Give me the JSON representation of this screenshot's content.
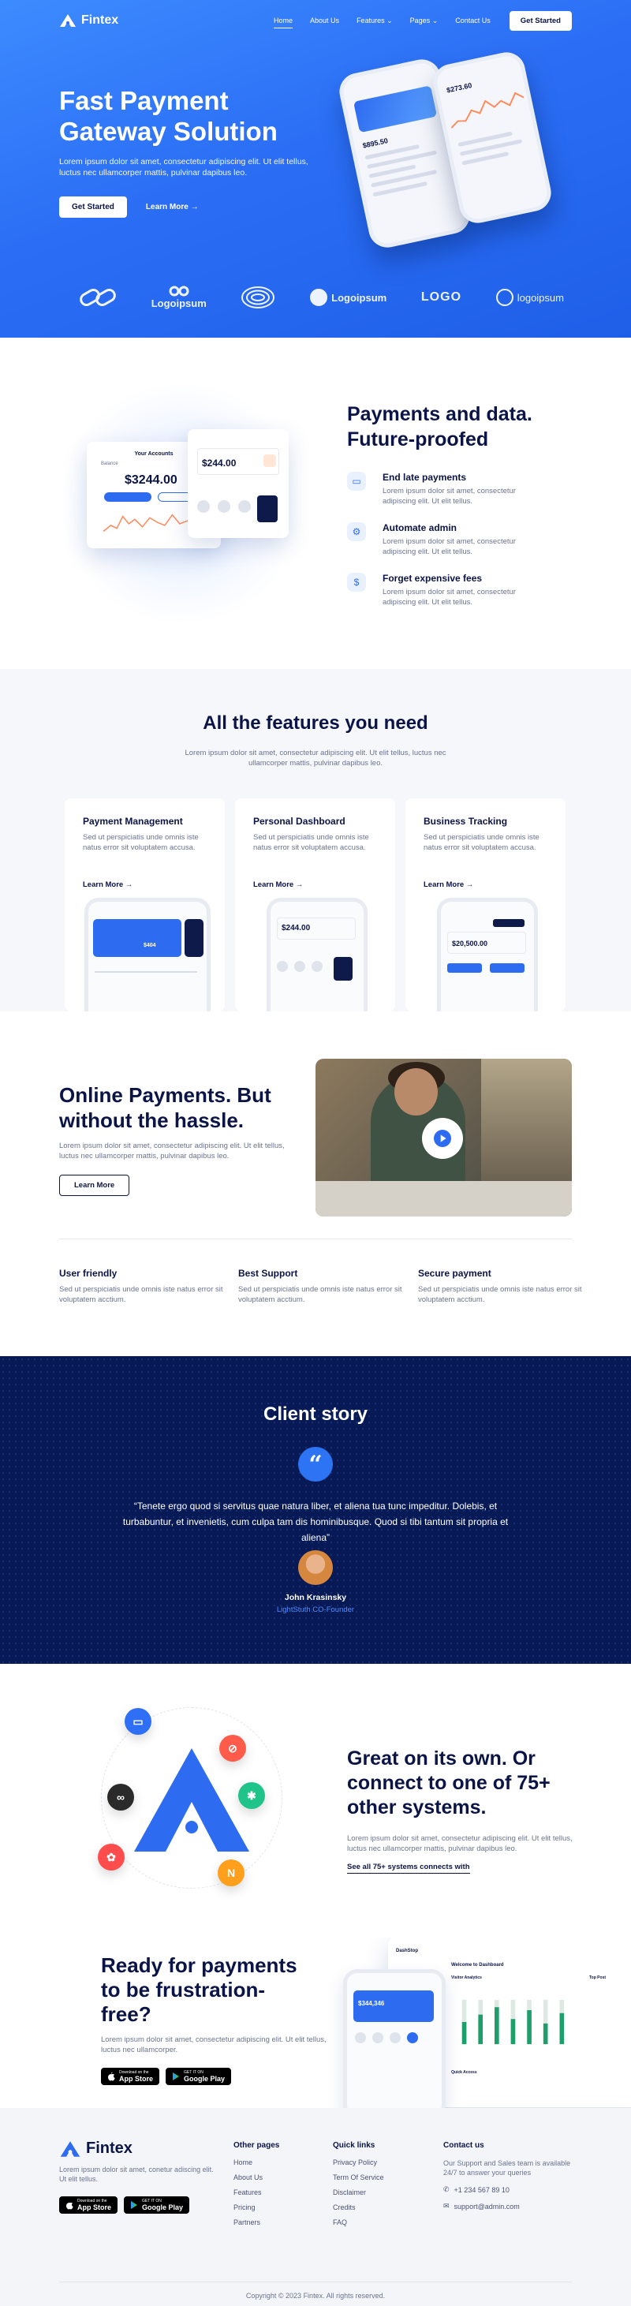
{
  "brand": {
    "name": "Fintex",
    "accent": "#2d6cf0",
    "navy": "#081a56"
  },
  "nav": {
    "links": [
      "Home",
      "About Us",
      "Features",
      "Pages",
      "Contact Us"
    ],
    "cta": "Get Started"
  },
  "hero": {
    "title": "Fast Payment Gateway Solution",
    "subtitle": "Lorem ipsum dolor sit amet, consectetur adipiscing elit. Ut elit tellus, luctus nec ullamcorper mattis, pulvinar dapibus leo.",
    "primary_btn": "Get Started",
    "secondary_btn": "Learn More",
    "phone_balance": "$895.50",
    "phone_balance2": "$273.60"
  },
  "logos": [
    "",
    "Logoipsum",
    "",
    "Logoipsum",
    "LOGO",
    "logoipsum"
  ],
  "payments": {
    "title": "Payments and data. Future-proofed",
    "dashboard": {
      "title": "Your Accounts",
      "label": "Balance",
      "balance": "$3244.00",
      "side_balance": "$244.00"
    },
    "features": [
      {
        "title": "End late payments",
        "text": "Lorem ipsum dolor sit amet, consectetur adipiscing elit. Ut elit tellus."
      },
      {
        "title": "Automate admin",
        "text": "Lorem ipsum dolor sit amet, consectetur adipiscing elit. Ut elit tellus."
      },
      {
        "title": "Forget expensive fees",
        "text": "Lorem ipsum dolor sit amet, consectetur adipiscing elit. Ut elit tellus."
      }
    ]
  },
  "features": {
    "title": "All the features you need",
    "lead": "Lorem ipsum dolor sit amet, consectetur adipiscing elit. Ut elit tellus, luctus nec ullamcorper mattis, pulvinar dapibus leo.",
    "cards": [
      {
        "title": "Payment Management",
        "text": "Sed ut perspiciatis unde omnis iste natus error sit voluptatem accusa.",
        "more": "Learn More",
        "amount": "$404"
      },
      {
        "title": "Personal Dashboard",
        "text": "Sed ut perspiciatis unde omnis iste natus error sit voluptatem accusa.",
        "more": "Learn More",
        "amount": "$244.00"
      },
      {
        "title": "Business Tracking",
        "text": "Sed ut perspiciatis unde omnis iste natus error sit voluptatem accusa.",
        "more": "Learn More",
        "amount": "$20,500.00"
      }
    ]
  },
  "online": {
    "title": "Online Payments. But without the hassle.",
    "subtitle": "Lorem ipsum dolor sit amet, consectetur adipiscing elit. Ut elit tellus, luctus nec ullamcorper mattis, pulvinar dapibus leo.",
    "button": "Learn More",
    "perks": [
      {
        "title": "User friendly",
        "text": "Sed ut perspiciatis unde omnis iste natus error sit voluptatem acctium."
      },
      {
        "title": "Best Support",
        "text": "Sed ut perspiciatis unde omnis iste natus error sit voluptatem acctium."
      },
      {
        "title": "Secure payment",
        "text": "Sed ut perspiciatis unde omnis iste natus error sit voluptatem acctium."
      }
    ]
  },
  "client": {
    "title": "Client story",
    "quote": "“Tenete ergo quod si servitus quae natura liber, et aliena tua tunc impeditur. Dolebis, et turbabuntur, et invenietis, cum culpa tam dis hominibusque. Quod si tibi tantum sit propria et aliena”",
    "name": "John Krasinsky",
    "role": "LightStuth CO-Founder"
  },
  "integrations": {
    "title": "Great on its own. Or connect to one of 75+ other systems.",
    "subtitle": "Lorem ipsum dolor sit amet, consectetur adipiscing elit. Ut elit tellus, luctus nec ullamcorper mattis, pulvinar dapibus leo.",
    "link": "See all 75+ systems connects with",
    "bubble_colors": [
      "#2f6ff5",
      "#ff5b4a",
      "#2a2a2a",
      "#20c38a",
      "#ff4d4d",
      "#ff9f1c"
    ]
  },
  "ready": {
    "title": "Ready for payments to be frustration-free?",
    "subtitle": "Lorem ipsum dolor sit amet, consectetur adipiscing elit. Ut elit tellus, luctus nec ullamcorper.",
    "app_store": {
      "small": "Download on the",
      "big": "App Store"
    },
    "google_play": {
      "small": "GET IT ON",
      "big": "Google Play"
    },
    "dashboard": {
      "brand": "DashStop",
      "heading": "Welcome to Dashboard",
      "panel": "Visitor Analytics",
      "side": "Top Post",
      "quick": "Quick Access"
    },
    "phone_amount": "$344,346"
  },
  "footer": {
    "name": "Fintex",
    "desc": "Lorem ipsum dolor sit amet, conetur adiscing elit. Ut elit tellus.",
    "columns": [
      {
        "title": "Other pages",
        "items": [
          "Home",
          "About Us",
          "Features",
          "Pricing",
          "Partners"
        ]
      },
      {
        "title": "Quick links",
        "items": [
          "Privacy Policy",
          "Term Of Service",
          "Disclaimer",
          "Credits",
          "FAQ"
        ]
      }
    ],
    "contact": {
      "title": "Contact us",
      "text": "Our Support and Sales team is available 24/7 to answer your queries",
      "phone": "+1 234 567 89 10",
      "email": "support@admin.com"
    },
    "copyright": "Copyright © 2023 Fintex. All rights reserved."
  }
}
